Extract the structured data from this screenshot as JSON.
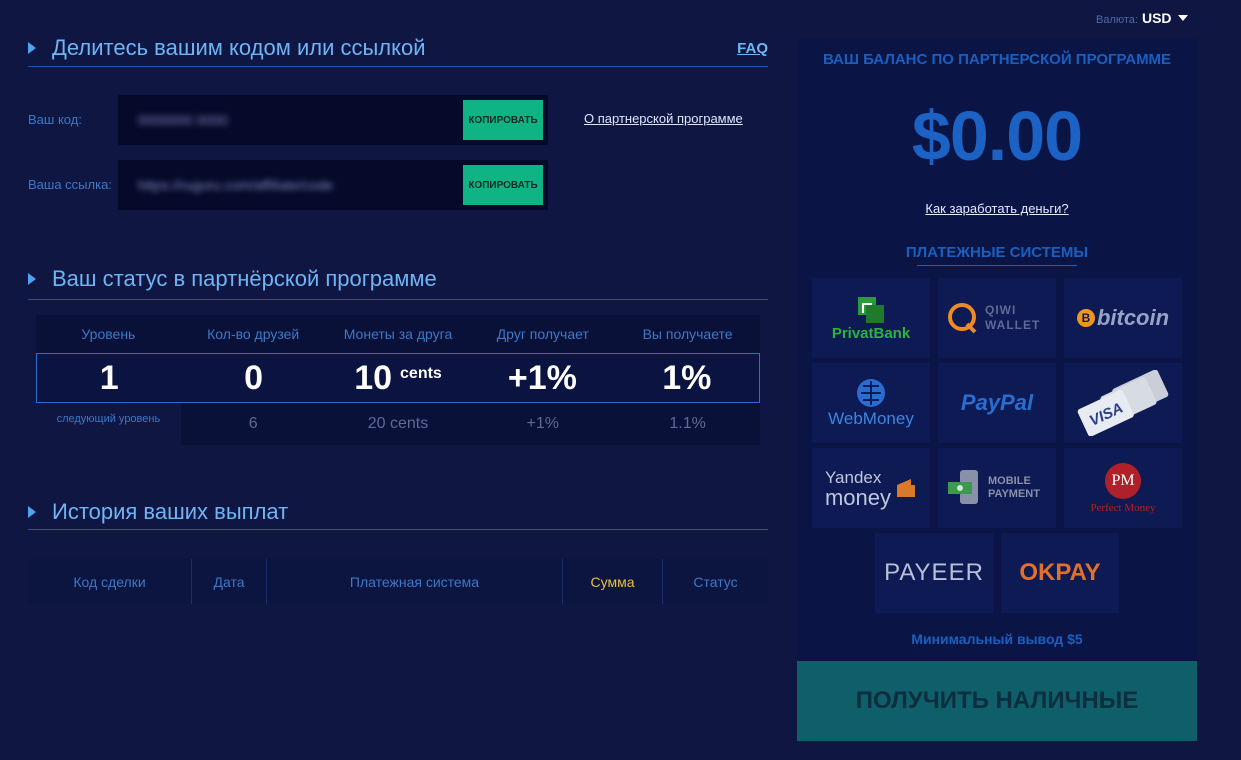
{
  "currency": {
    "label": "Валюта:",
    "value": "USD"
  },
  "share": {
    "title": "Делитесь вашим кодом или ссылкой",
    "faq": "FAQ",
    "code_label": "Ваш код:",
    "code_value": "0000000 0000",
    "link_label": "Ваша ссылка:",
    "link_value": "https://ruguru.com/affiliate/code",
    "copy_label": "КОПИРОВАТЬ",
    "about_link": "О партнерской программе"
  },
  "status": {
    "title": "Ваш статус в партнёрской программе",
    "headers": [
      "Уровень",
      "Кол-во друзей",
      "Монеты за друга",
      "Друг получает",
      "Вы получаете"
    ],
    "current": {
      "level": "1",
      "friends": "0",
      "coins": "10",
      "coins_unit": "cents",
      "friend_gets": "+1%",
      "you_get": "1%"
    },
    "next_label": "следующий уровень",
    "next": {
      "friends": "6",
      "coins": "20 cents",
      "friend_gets": "+1%",
      "you_get": "1.1%"
    }
  },
  "history": {
    "title": "История ваших выплат",
    "columns": [
      "Код сделки",
      "Дата",
      "Платежная система",
      "Сумма",
      "Статус"
    ]
  },
  "panel": {
    "title": "ВАШ БАЛАНС ПО ПАРТНЕРСКОЙ ПРОГРАММЕ",
    "balance": "$0.00",
    "how_link": "Как заработать деньги?",
    "payments_title": "ПЛАТЕЖНЫЕ СИСТЕМЫ",
    "logos": {
      "privatbank": "PrivatBank",
      "qiwi": "QIWI WALLET",
      "bitcoin": "bitcoin",
      "webmoney": "WebMoney",
      "paypal": "PayPal",
      "visa": "VISA",
      "yandex_top": "Yandex",
      "yandex_bottom": "money",
      "mobile": "MOBILE PAYMENT",
      "pm_short": "PM",
      "pm": "Perfect Money",
      "payeer": "PAYEER",
      "okpay": "OKPAY"
    },
    "min_withdraw": "Минимальный вывод $5",
    "cash_button": "ПОЛУЧИТЬ НАЛИЧНЫЕ"
  },
  "colors": {
    "background": "#0f1642",
    "accent": "#1a5fc0",
    "copy_button": "#10b484",
    "active_column": "#e9c13a"
  }
}
